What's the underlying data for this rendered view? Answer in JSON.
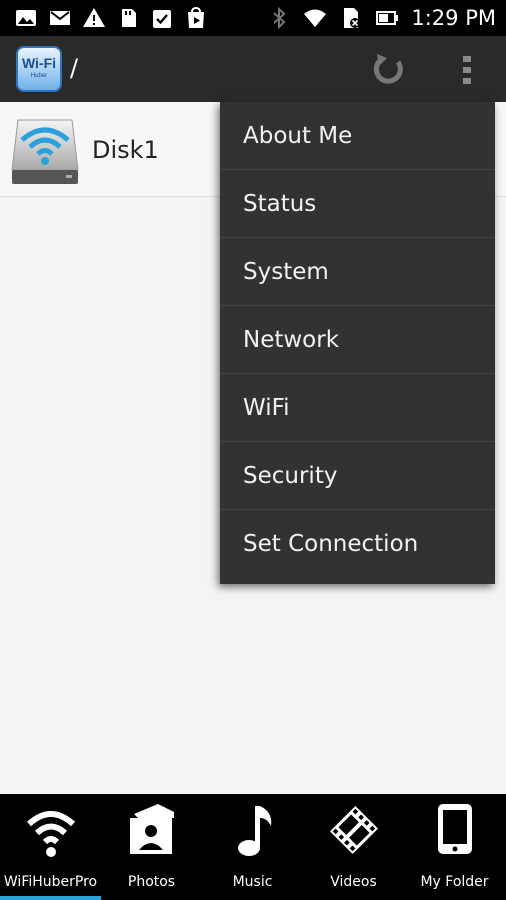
{
  "status_bar": {
    "time": "1:29 PM",
    "left_icons": [
      "photo-icon",
      "gmail-icon",
      "warning-icon",
      "sd-card-icon",
      "clipboard-check-icon",
      "play-store-icon"
    ],
    "right_icons": [
      "bluetooth-icon",
      "wifi-signal-icon",
      "sim-icon",
      "battery-icon"
    ]
  },
  "action_bar": {
    "logo_text": "Wi-Fi",
    "logo_subtext": "Huber",
    "path": "/",
    "refresh_icon": "refresh-icon",
    "overflow_icon": "overflow-menu-icon"
  },
  "file_list": [
    {
      "label": "Disk1",
      "icon": "wifi-drive-icon"
    }
  ],
  "menu": {
    "items": [
      "About Me",
      "Status",
      "System",
      "Network",
      "WiFi",
      "Security",
      "Set Connection"
    ]
  },
  "tabs": [
    {
      "label": "WiFiHuberPro",
      "icon": "wifi-icon",
      "active": true
    },
    {
      "label": "Photos",
      "icon": "photos-icon",
      "active": false
    },
    {
      "label": "Music",
      "icon": "music-note-icon",
      "active": false
    },
    {
      "label": "Videos",
      "icon": "film-icon",
      "active": false
    },
    {
      "label": "My Folder",
      "icon": "tablet-icon",
      "active": false
    }
  ],
  "colors": {
    "status_bar": "#000000",
    "action_bar": "#2a2a2a",
    "menu_background": "#323232",
    "tab_indicator": "#27a3d8",
    "wifi_accent": "#2aa0dd"
  }
}
